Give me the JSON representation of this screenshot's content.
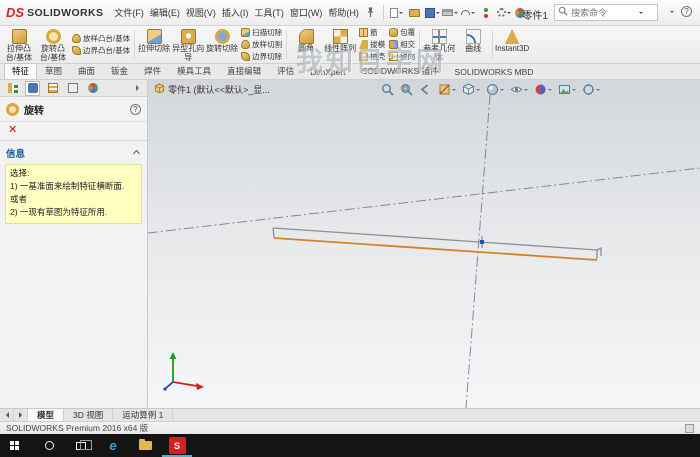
{
  "window": {
    "logo_mark": "DS",
    "logo_text": "SOLIDWORKS",
    "title": "零件1",
    "search_placeholder": "搜索命令",
    "help_glyph": "?"
  },
  "menus": [
    "文件(F)",
    "编辑(E)",
    "视图(V)",
    "插入(I)",
    "工具(T)",
    "窗口(W)",
    "帮助(H)"
  ],
  "ribbon": {
    "large": [
      "拉伸凸台/基体",
      "旋转凸台/基体",
      "拉伸切除",
      "异型孔向导",
      "旋转切除",
      "圆角",
      "线性阵列",
      "参考几何体",
      "曲线",
      "Instant3D"
    ],
    "small": [
      "放样凸台/基体",
      "边界凸台/基体",
      "扫描切除",
      "放样切割",
      "边界切除",
      "筋",
      "拔模",
      "抽壳",
      "包覆",
      "相交",
      "镜向"
    ]
  },
  "tabs": {
    "items": [
      "特征",
      "草图",
      "曲面",
      "钣金",
      "焊件",
      "模具工具",
      "直接编辑",
      "评估",
      "DimXpert",
      "SOLIDWORKS 插件",
      "SOLIDWORKS MBD"
    ],
    "active": "特征"
  },
  "panel": {
    "title": "旋转",
    "help_glyph": "?",
    "close_glyph": "✕",
    "section_label": "信息",
    "message_lines": [
      "选择:",
      "1) 一基准面来绘制特征横断面.",
      "或者",
      "2) 一现有草图为特征所用."
    ]
  },
  "viewport": {
    "doc_label": "零件1 (默认<<默认>_显..."
  },
  "bottom_tabs": {
    "items": [
      "模型",
      "3D 视图",
      "运动算例 1"
    ],
    "active": "模型"
  },
  "statusbar": {
    "text": "SOLIDWORKS Premium 2016 x64 版"
  },
  "taskbar": {
    "edge_glyph": "e",
    "solidworks_glyph": "S"
  },
  "watermark": {
    "text": "我知目字网"
  },
  "colors": {
    "logo_red": "#d2232a",
    "accent_blue": "#3f7fbf",
    "info_yellow": "#ffffc2",
    "line_orange": "#d4822a",
    "line_gray": "#8b9096",
    "centerline_gray": "#85898f",
    "origin_blue": "#2050c8",
    "viewport_top": "#d3d7db",
    "viewport_mid": "#e7e9eb",
    "viewport_bottom": "#f5f6f7",
    "taskbar_bg": "#141414",
    "icon_gold": "#e3b04b"
  }
}
